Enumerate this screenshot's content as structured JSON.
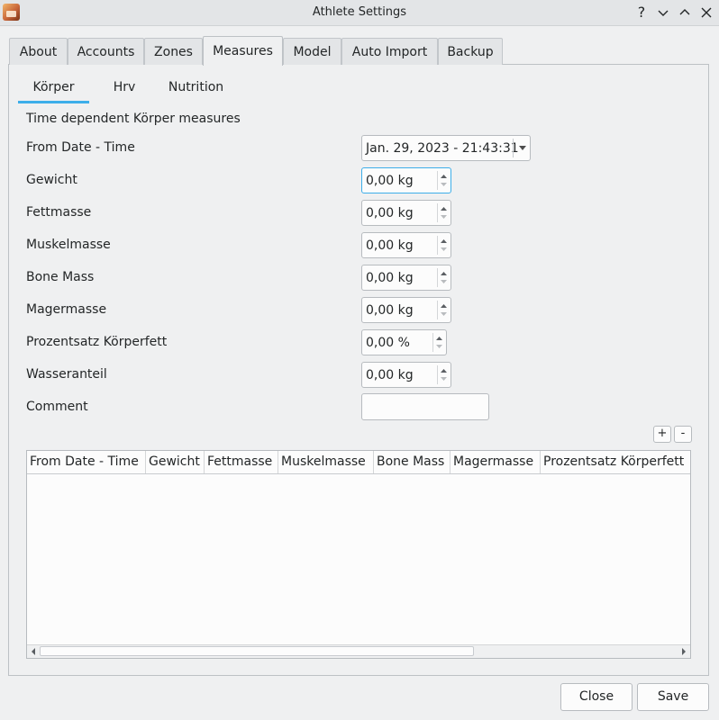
{
  "window": {
    "title": "Athlete Settings",
    "help_label": "?"
  },
  "tabs": [
    {
      "label": "About"
    },
    {
      "label": "Accounts"
    },
    {
      "label": "Zones"
    },
    {
      "label": "Measures"
    },
    {
      "label": "Model"
    },
    {
      "label": "Auto Import"
    },
    {
      "label": "Backup"
    }
  ],
  "active_tab": "Measures",
  "subtabs": [
    {
      "label": "Körper"
    },
    {
      "label": "Hrv"
    },
    {
      "label": "Nutrition"
    }
  ],
  "active_subtab": "Körper",
  "form": {
    "section_title": "Time dependent Körper measures",
    "from_date_label": "From Date - Time",
    "from_date_value": "Jan. 29, 2023 - 21:43:31",
    "fields": [
      {
        "label": "Gewicht",
        "value": "0,00 kg"
      },
      {
        "label": "Fettmasse",
        "value": "0,00 kg"
      },
      {
        "label": "Muskelmasse",
        "value": "0,00 kg"
      },
      {
        "label": "Bone Mass",
        "value": "0,00 kg"
      },
      {
        "label": "Magermasse",
        "value": "0,00 kg"
      },
      {
        "label": "Prozentsatz Körperfett",
        "value": "0,00 %"
      },
      {
        "label": "Wasseranteil",
        "value": "0,00 kg"
      }
    ],
    "comment_label": "Comment",
    "comment_value": ""
  },
  "table": {
    "add_label": "+",
    "remove_label": "-",
    "columns": [
      "From Date - Time",
      "Gewicht",
      "Fettmasse",
      "Muskelmasse",
      "Bone Mass",
      "Magermasse",
      "Prozentsatz Körperfett"
    ],
    "rows": []
  },
  "footer": {
    "close_label": "Close",
    "save_label": "Save"
  },
  "colors": {
    "accent": "#3daee9",
    "background": "#eff0f1"
  }
}
